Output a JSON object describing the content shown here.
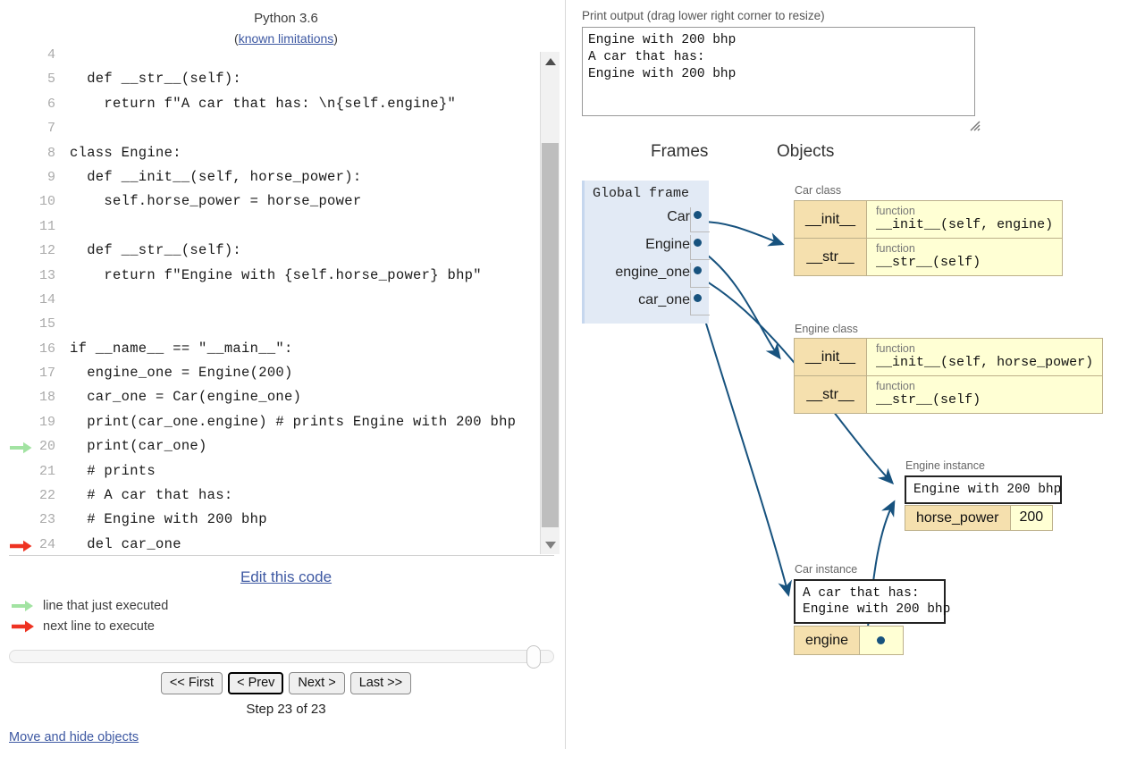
{
  "left": {
    "version_title": "Python 3.6",
    "known_limitations_prefix": "(",
    "known_limitations": "known limitations",
    "known_limitations_suffix": ")",
    "code_lines": [
      {
        "num": "4",
        "text": "",
        "marker": "none"
      },
      {
        "num": "5",
        "text": "  def __str__(self):",
        "marker": "none"
      },
      {
        "num": "6",
        "text": "    return f\"A car that has: \\n{self.engine}\"",
        "marker": "none"
      },
      {
        "num": "7",
        "text": "",
        "marker": "none"
      },
      {
        "num": "8",
        "text": "class Engine:",
        "marker": "none"
      },
      {
        "num": "9",
        "text": "  def __init__(self, horse_power):",
        "marker": "none"
      },
      {
        "num": "10",
        "text": "    self.horse_power = horse_power",
        "marker": "none"
      },
      {
        "num": "11",
        "text": "",
        "marker": "none"
      },
      {
        "num": "12",
        "text": "  def __str__(self):",
        "marker": "none"
      },
      {
        "num": "13",
        "text": "    return f\"Engine with {self.horse_power} bhp\"",
        "marker": "none"
      },
      {
        "num": "14",
        "text": "",
        "marker": "none"
      },
      {
        "num": "15",
        "text": "",
        "marker": "none"
      },
      {
        "num": "16",
        "text": "if __name__ == \"__main__\":",
        "marker": "none"
      },
      {
        "num": "17",
        "text": "  engine_one = Engine(200)",
        "marker": "none"
      },
      {
        "num": "18",
        "text": "  car_one = Car(engine_one)",
        "marker": "none"
      },
      {
        "num": "19",
        "text": "  print(car_one.engine) # prints Engine with 200 bhp",
        "marker": "none"
      },
      {
        "num": "20",
        "text": "  print(car_one)",
        "marker": "green"
      },
      {
        "num": "21",
        "text": "  # prints",
        "marker": "none"
      },
      {
        "num": "22",
        "text": "  # A car that has:",
        "marker": "none"
      },
      {
        "num": "23",
        "text": "  # Engine with 200 bhp",
        "marker": "none"
      },
      {
        "num": "24",
        "text": "  del car_one",
        "marker": "red"
      }
    ],
    "edit_this_code": "Edit this code",
    "legend": [
      {
        "icon": "green-arrow-icon",
        "label": "line that just executed"
      },
      {
        "icon": "red-arrow-icon",
        "label": "next line to execute"
      }
    ],
    "nav_buttons": [
      {
        "id": "first",
        "label": "<< First",
        "focused": false
      },
      {
        "id": "prev",
        "label": "< Prev",
        "focused": true
      },
      {
        "id": "next",
        "label": "Next >",
        "focused": false
      },
      {
        "id": "last",
        "label": "Last >>",
        "focused": false
      }
    ],
    "step_label": "Step 23 of 23",
    "move_and_hide": "Move and hide objects",
    "slider_position_percent": 100
  },
  "right": {
    "print_output_label": "Print output (drag lower right corner to resize)",
    "print_output_text": "Engine with 200 bhp\nA car that has:\nEngine with 200 bhp",
    "frames_heading": "Frames",
    "objects_heading": "Objects",
    "global_frame": {
      "title": "Global frame",
      "variables": [
        {
          "name": "Car"
        },
        {
          "name": "Engine"
        },
        {
          "name": "engine_one"
        },
        {
          "name": "car_one"
        }
      ]
    },
    "objects": {
      "car_class": {
        "label": "Car class",
        "rows": [
          {
            "key": "__init__",
            "type": "function",
            "signature": "__init__(self, engine)"
          },
          {
            "key": "__str__",
            "type": "function",
            "signature": "__str__(self)"
          }
        ]
      },
      "engine_class": {
        "label": "Engine class",
        "rows": [
          {
            "key": "__init__",
            "type": "function",
            "signature": "__init__(self, horse_power)"
          },
          {
            "key": "__str__",
            "type": "function",
            "signature": "__str__(self)"
          }
        ]
      },
      "engine_instance": {
        "label": "Engine instance",
        "header": "Engine with 200 bhp",
        "rows": [
          {
            "key": "horse_power",
            "value": "200"
          }
        ]
      },
      "car_instance": {
        "label": "Car instance",
        "header": "A car that has:\nEngine with 200 bhp",
        "rows": [
          {
            "key": "engine",
            "value": "pointer"
          }
        ]
      }
    }
  },
  "colors": {
    "link": "#3d58a2",
    "frame_bg": "#e2eaf5",
    "key_cell": "#f5e0ae",
    "value_cell": "#ffffd4",
    "object_border": "#a89b72",
    "pointer": "#17527e",
    "green_arrow": "#a2e3a2",
    "red_arrow": "#ee3322"
  }
}
